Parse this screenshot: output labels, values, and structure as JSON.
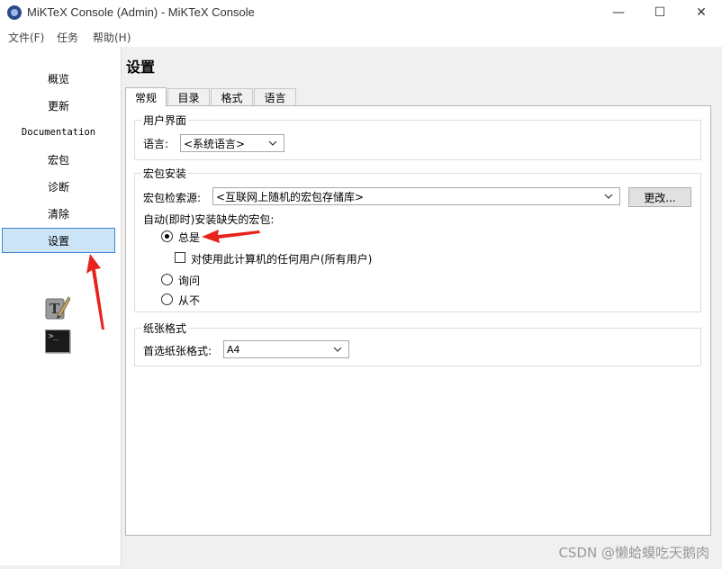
{
  "window": {
    "title": "MiKTeX Console (Admin) - MiKTeX Console",
    "minimize_glyph": "—",
    "maximize_glyph": "☐",
    "close_glyph": "✕"
  },
  "menu": {
    "items": [
      {
        "label": "文件(F)"
      },
      {
        "label": "任务"
      },
      {
        "label": "帮助(H)"
      }
    ]
  },
  "sidebar": {
    "items": [
      {
        "label": "概览"
      },
      {
        "label": "更新"
      },
      {
        "label": "Documentation"
      },
      {
        "label": "宏包"
      },
      {
        "label": "诊断"
      },
      {
        "label": "清除"
      },
      {
        "label": "设置",
        "selected": true
      }
    ],
    "icons": [
      "tex-works-icon",
      "terminal-icon"
    ],
    "terminal_prompt": ">_"
  },
  "page": {
    "title": "设置",
    "tabs": [
      {
        "label": "常规",
        "active": true
      },
      {
        "label": "目录"
      },
      {
        "label": "格式"
      },
      {
        "label": "语言"
      }
    ]
  },
  "ui_group": {
    "title": "用户界面",
    "language_label": "语言:",
    "language_value": "<系统语言>"
  },
  "install_group": {
    "title": "宏包安装",
    "repo_label": "宏包检索源:",
    "repo_value": "<互联网上随机的宏包存储库>",
    "change_button": "更改...",
    "auto_install_label": "自动(即时)安装缺失的宏包:",
    "options": [
      {
        "label": "总是",
        "checked": true
      },
      {
        "label": "询问",
        "checked": false
      },
      {
        "label": "从不",
        "checked": false
      }
    ],
    "all_users_label": "对使用此计算机的任何用户(所有用户)",
    "all_users_checked": false
  },
  "paper_group": {
    "title": "纸张格式",
    "paper_label": "首选纸张格式:",
    "paper_value": "A4"
  },
  "watermark": "CSDN @懒蛤蟆吃天鹅肉",
  "colors": {
    "selection_bg": "#cce4f7",
    "selection_border": "#3c86d1",
    "annotation_arrow": "#e8231b"
  }
}
